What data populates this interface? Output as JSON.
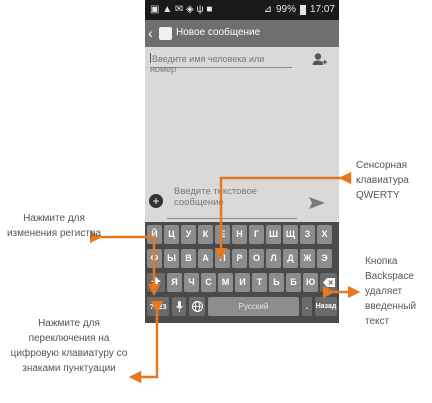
{
  "status_bar": {
    "left_icons": "▣ ▲ ✉ ◈ ψ ■",
    "battery": "99%",
    "time": "17:07"
  },
  "action_bar": {
    "back": "‹",
    "title": "Новое сообщение"
  },
  "recipient": {
    "placeholder": "Введите имя человека или номер"
  },
  "compose": {
    "placeholder": "Введите текстовое сообщение"
  },
  "keyboard": {
    "row1": [
      "Й",
      "Ц",
      "У",
      "К",
      "Е",
      "Н",
      "Г",
      "Ш",
      "Щ",
      "З",
      "Х"
    ],
    "row2": [
      "Ф",
      "Ы",
      "В",
      "А",
      "П",
      "Р",
      "О",
      "Л",
      "Д",
      "Ж",
      "Э"
    ],
    "row3": [
      "Я",
      "Ч",
      "С",
      "М",
      "И",
      "Т",
      "Ь",
      "Б",
      "Ю"
    ],
    "numeric": "?123",
    "space": "Русский",
    "period": ".",
    "enter": "Назад"
  },
  "annotations": {
    "qwerty": "Сенсорная клавиатура QWERTY",
    "shift": "Нажмите для изменения регистра",
    "backspace": "Кнопка Backspace удаляет введенный текст",
    "numeric": "Нажмите для переключения на цифровую клавиатуру со знаками пунктуации"
  },
  "colors": {
    "arrow": "#e8781e",
    "keyboard_bg": "#4a4a4a",
    "key": "#8c8c8c"
  }
}
